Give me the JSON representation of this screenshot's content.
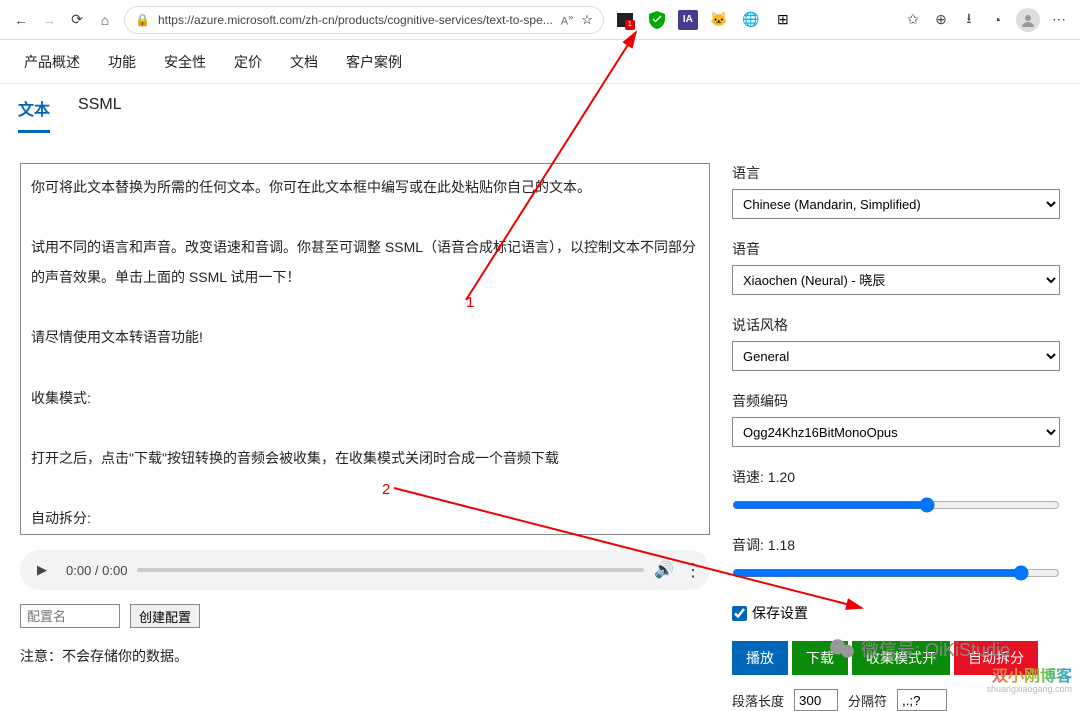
{
  "browser": {
    "url": "https://azure.microsoft.com/zh-cn/products/cognitive-services/text-to-spe..."
  },
  "nav": [
    "产品概述",
    "功能",
    "安全性",
    "定价",
    "文档",
    "客户案例"
  ],
  "tabs": [
    "文本",
    "SSML"
  ],
  "textarea_value": "你可将此文本替换为所需的任何文本。你可在此文本框中编写或在此处粘贴你自己的文本。\n\n试用不同的语言和声音。改变语速和音调。你甚至可调整 SSML（语音合成标记语言），以控制文本不同部分的声音效果。单击上面的 SSML 试用一下！\n\n请尽情使用文本转语音功能!\n\n收集模式:\n\n打开之后，点击\"下载\"按钮转换的音频会被收集，在收集模式关闭时合成一个音频下载\n\n自动拆分:\n\n将长文本拆分为多个接近\"段落长度\"的片段，并只在\"分隔符\"处截断，避免句子被截断，影响阅读效果\n\n\n拖拽 txt 文件至此框可加载文本文件",
  "audio_time": "0:00 / 0:00",
  "config": {
    "placeholder": "配置名",
    "button": "创建配置"
  },
  "note": "注意：不会存储你的数据。",
  "right": {
    "language_label": "语言",
    "language_value": "Chinese (Mandarin, Simplified)",
    "voice_label": "语音",
    "voice_value": "Xiaochen (Neural) - 晓辰",
    "style_label": "说话风格",
    "style_value": "General",
    "encoding_label": "音频编码",
    "encoding_value": "Ogg24Khz16BitMonoOpus",
    "speed_label": "语速: 1.20",
    "pitch_label": "音调: 1.18",
    "save_label": "保存设置",
    "buttons": {
      "play": "播放",
      "download": "下载",
      "collect": "收集模式开",
      "split": "自动拆分"
    },
    "bottom": {
      "para_label": "段落长度",
      "para_value": "300",
      "sep_label": "分隔符",
      "sep_value": ",.;?"
    }
  },
  "annotations": {
    "a1": "1",
    "a2": "2"
  },
  "wechat": "微信号: QiKiStudio",
  "blog": {
    "title": "双小刚博客",
    "url": "shuangxiaogang.com"
  }
}
